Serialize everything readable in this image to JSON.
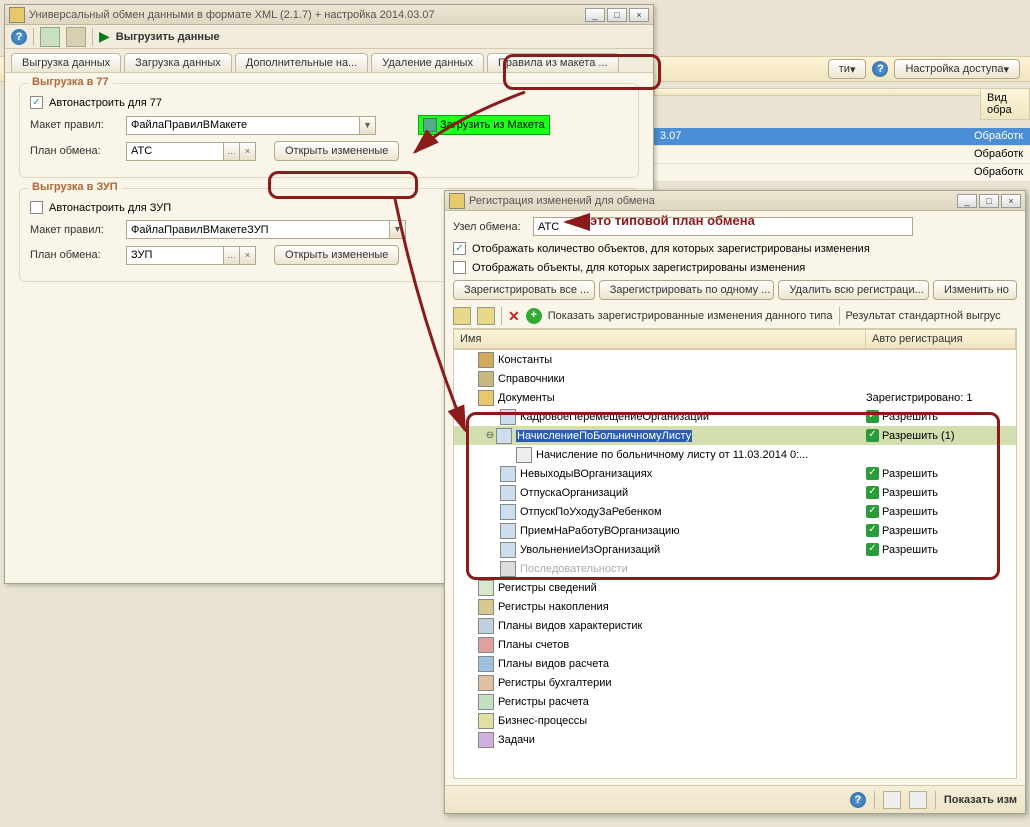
{
  "strip": {
    "btn_right": "ти",
    "settings": "Настройка доступа"
  },
  "grid": {
    "col2": "Вид обра",
    "rows": [
      "3.07",
      "",
      ""
    ],
    "r2": [
      "Обработк",
      "Обработк",
      "Обработк"
    ]
  },
  "win1": {
    "title": "Универсальный обмен данными в формате XML (2.1.7) + настройка 2014.03.07",
    "toolbar": {
      "export": "Выгрузить данные"
    },
    "tabs": [
      "Выгрузка данных",
      "Загрузка данных",
      "Дополнительные на...",
      "Удаление данных",
      "Правила из макета ..."
    ],
    "grp77": {
      "title": "Выгрузка в 77",
      "auto": "Автонастроить для 77",
      "maket_lbl": "Макет правил:",
      "maket_val": "ФайлаПравилВМакете",
      "load_btn": "Загрузить из Макета",
      "plan_lbl": "План обмена:",
      "plan_val": "АТС",
      "open_btn": "Открыть измененые"
    },
    "grpzup": {
      "title": "Выгрузка в ЗУП",
      "auto": "Автонастроить для ЗУП",
      "maket_lbl": "Макет правил:",
      "maket_val": "ФайлаПравилВМакетеЗУП",
      "plan_lbl": "План обмена:",
      "plan_val": "ЗУП",
      "open_btn": "Открыть измененые"
    }
  },
  "win2": {
    "title": "Регистрация изменений для обмена",
    "node_lbl": "Узел обмена:",
    "node_val": "АТС",
    "chk1": "Отображать количество объектов, для которых зарегистрированы изменения",
    "chk2": "Отображать объекты, для которых зарегистрированы изменения",
    "btns": [
      "Зарегистрировать все ...",
      "Зарегистрировать по одному ...",
      "Удалить всю регистраци...",
      "Изменить но"
    ],
    "link1": "Показать зарегистрированные изменения данного типа",
    "link2": "Результат стандартной выгрус",
    "th1": "Имя",
    "th2": "Авто регистрация",
    "tree": {
      "konst": "Константы",
      "sprav": "Справочники",
      "docs": "Документы",
      "docs_r": "Зарегистрировано: 1",
      "d1": "КадровоеПеремещениеОрганизаций",
      "d2": "НачислениеПоБольничномуЛисту",
      "d2sub": "Начисление по больничному листу                        от 11.03.2014 0:...",
      "d3": "НевыходыВОрганизациях",
      "d4": "ОтпускаОрганизаций",
      "d5": "ОтпускПоУходуЗаРебенком",
      "d6": "ПриемНаРаботуВОрганизацию",
      "d7": "УвольнениеИзОрганизаций",
      "d8": "Последовательности",
      "rs": "Регистры сведений",
      "rn": "Регистры накопления",
      "pvh": "Планы видов характеристик",
      "ps": "Планы счетов",
      "pvr": "Планы видов расчета",
      "rb": "Регистры бухгалтерии",
      "rr": "Регистры расчета",
      "bp": "Бизнес-процессы",
      "zad": "Задачи",
      "allow": "Разрешить",
      "allow1": "Разрешить (1)"
    },
    "footer_btn": "Показать изм"
  },
  "annotation": "это типовой план обмена"
}
